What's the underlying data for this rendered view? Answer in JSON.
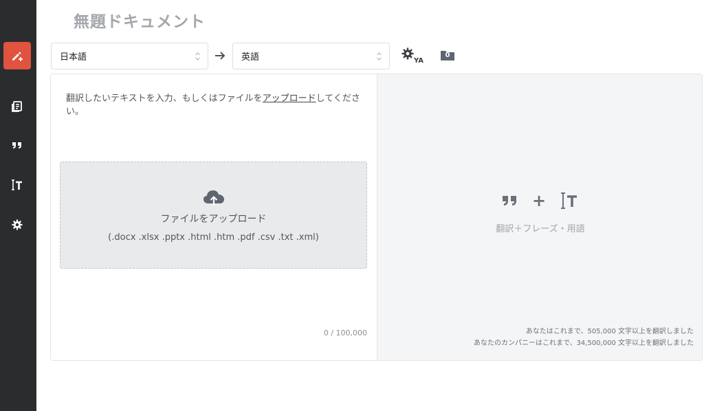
{
  "document": {
    "title": "無題ドキュメント"
  },
  "languages": {
    "source": "日本語",
    "target": "英語"
  },
  "toolbar": {
    "badge_count": "0"
  },
  "editor": {
    "hint_before": "翻訳したいテキストを入力、もしくはファイルを",
    "hint_link": "アップロード",
    "hint_after": "してください。",
    "upload_title": "ファイルをアップロード",
    "upload_extensions": "(.docx .xlsx .pptx .html .htm .pdf .csv .txt .xml)",
    "counter": "0 / 100,000"
  },
  "output": {
    "plus": "+",
    "feature_label": "翻訳＋フレーズ・用語",
    "stat_personal": "あなたはこれまで、505,000 文字以上を翻訳しました",
    "stat_company": "あなたのカンパニーはこれまで、34,500,000 文字以上を翻訳しました"
  },
  "colors": {
    "sidebar": "#2b2c2e",
    "accent": "#e0533f",
    "muted": "#a3a6ab"
  },
  "icons": [
    "new-translation-icon",
    "documents-icon",
    "phrases-icon",
    "glossary-icon",
    "settings-icon",
    "translate-settings-icon",
    "folder-icon",
    "cloud-upload-icon"
  ]
}
